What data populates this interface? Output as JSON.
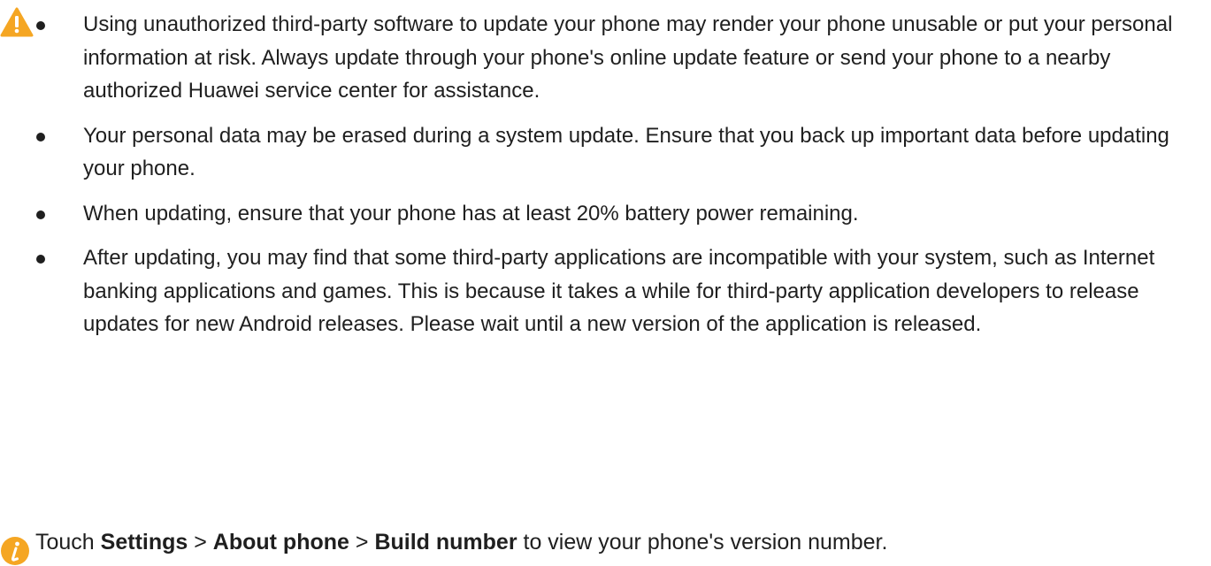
{
  "warning": {
    "icon": "warning-triangle-icon",
    "icon_color": "#F5A623",
    "bullets": [
      "Using unauthorized third-party software to update your phone may render your phone unusable or put your personal information at risk. Always update through your phone's online update feature or send your phone to a nearby authorized Huawei service center for assistance.",
      "Your personal data may be erased during a system update. Ensure that you back up important data before updating your phone.",
      "When updating, ensure that your phone has at least 20% battery power remaining.",
      "After updating, you may find that some third-party applications are incompatible with your system, such as Internet banking applications and games. This is because it takes a while for third-party application developers to release updates for new Android releases. Please wait until a new version of the application is released."
    ]
  },
  "note": {
    "icon": "info-icon",
    "icon_color": "#F5A623",
    "prefix": "Touch ",
    "settings": "Settings",
    "sep1": " > ",
    "about_phone": "About phone",
    "sep2": " > ",
    "build_number": "Build number",
    "suffix": " to view your phone's version number."
  }
}
